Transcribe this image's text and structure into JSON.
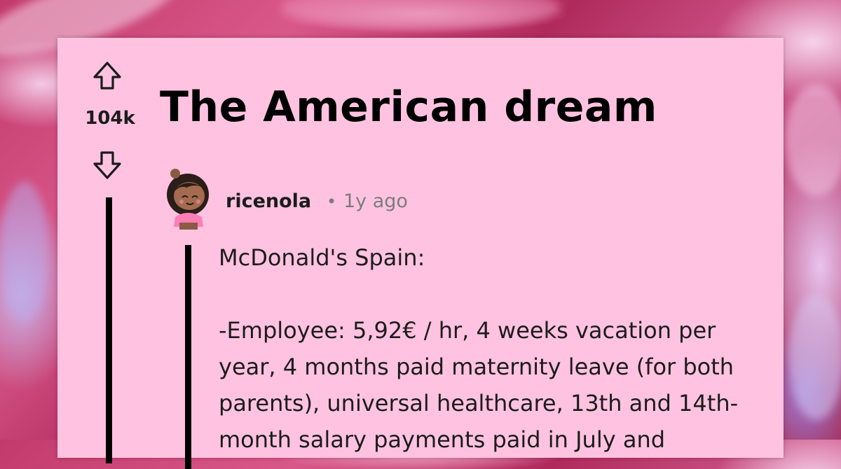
{
  "post": {
    "title": "The American dream",
    "score": "104k"
  },
  "comment": {
    "username": "ricenola",
    "separator": "•",
    "age": "1y ago",
    "paragraphs": [
      "McDonald's Spain:",
      "-Employee: 5,92€ / hr, 4 weeks vacation per year, 4 months paid maternity leave (for both parents), universal healthcare, 13th and 14th-month salary payments paid in July and"
    ]
  },
  "icons": {
    "upvote": "upvote-arrow-icon",
    "downvote": "downvote-arrow-icon",
    "avatar": "user-avatar"
  },
  "colors": {
    "card_background": "#ffc3e1",
    "text": "#1c1c1c",
    "muted": "#7c7c7c",
    "thread_line": "#000000"
  }
}
